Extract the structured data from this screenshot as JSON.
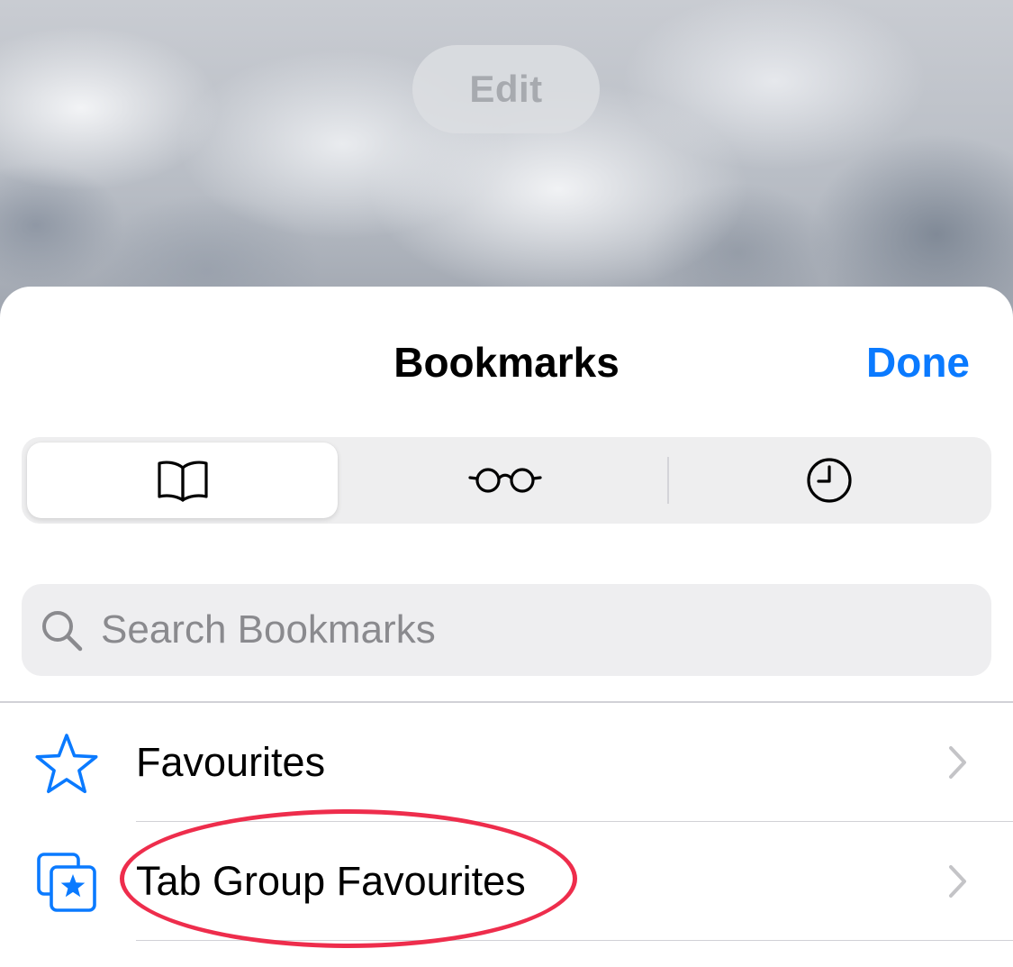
{
  "background": {
    "edit_label": "Edit"
  },
  "sheet": {
    "title": "Bookmarks",
    "done_label": "Done",
    "accent_color": "#0a7aff"
  },
  "segments": [
    {
      "icon": "book-icon",
      "selected": true
    },
    {
      "icon": "glasses-icon",
      "selected": false
    },
    {
      "icon": "clock-icon",
      "selected": false
    }
  ],
  "search": {
    "placeholder": "Search Bookmarks",
    "icon": "search-icon"
  },
  "list": [
    {
      "label": "Favourites",
      "icon": "star-icon"
    },
    {
      "label": "Tab Group Favourites",
      "icon": "tab-group-star-icon"
    }
  ],
  "annotation": {
    "shape": "ellipse",
    "color": "#ee2d4c",
    "target": "Tab Group Favourites"
  }
}
